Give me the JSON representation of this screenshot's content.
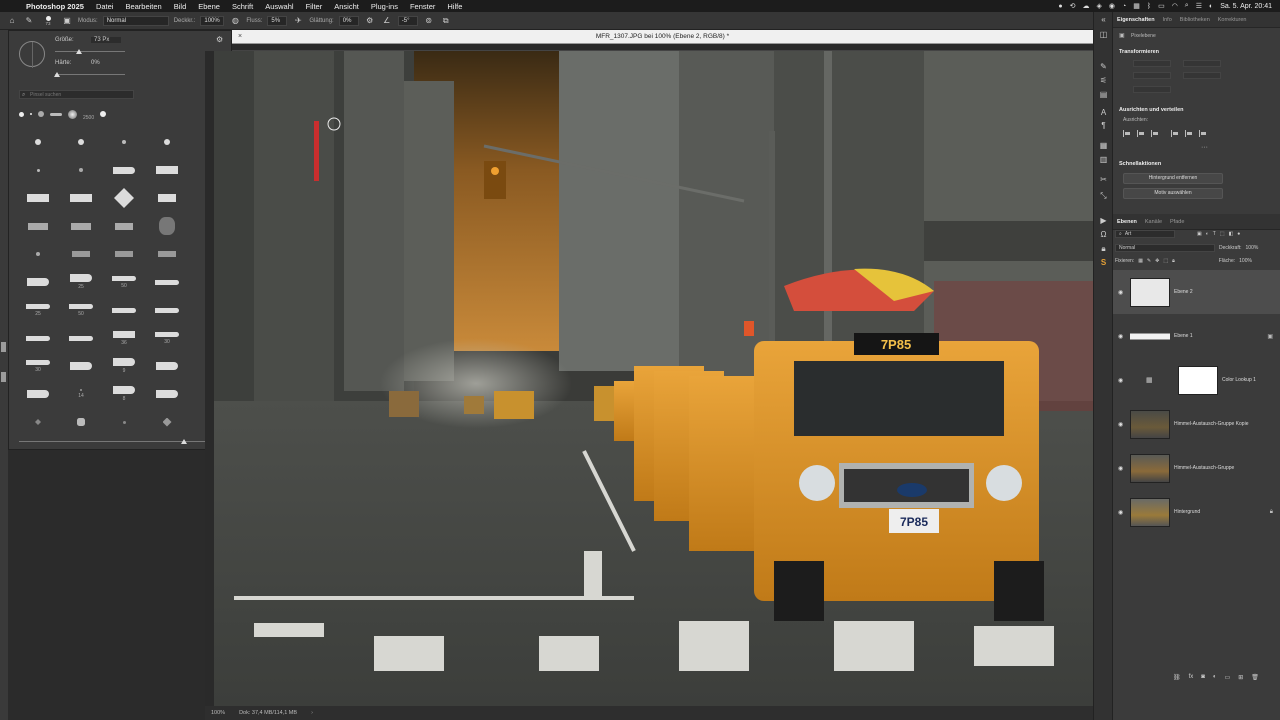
{
  "menubar": {
    "app_name": "Photoshop 2025",
    "items": [
      "Datei",
      "Bearbeiten",
      "Bild",
      "Ebene",
      "Schrift",
      "Auswahl",
      "Filter",
      "Ansicht",
      "Plug-ins",
      "Fenster",
      "Hilfe"
    ],
    "datetime": "Sa. 5. Apr. 20:41"
  },
  "options_bar": {
    "brush_size": "73",
    "mode_label": "Modus:",
    "mode_value": "Normal",
    "opacity_label": "Deckkr.:",
    "opacity_value": "100%",
    "flow_label": "Fluss:",
    "flow_value": "5%",
    "smoothing_label": "Glättung:",
    "smoothing_value": "0%",
    "angle_value": "-5°"
  },
  "brush_panel": {
    "size_label": "Größe:",
    "size_value": "73 Px",
    "hardness_label": "Härte:",
    "hardness_value": "0%",
    "search_placeholder": "Pinsel suchen",
    "recent_number": "2500",
    "brush_numbers": [
      "25",
      "50",
      "25",
      "50",
      "36",
      "30",
      "30",
      "9",
      "14",
      "8"
    ]
  },
  "document": {
    "title": "MFR_1307.JPG bei 100% (Ebene 2, RGB/8) *",
    "zoom": "100%",
    "doc_info": "Dok: 37,4 MB/114,1 MB",
    "taxi_plate": "7P85"
  },
  "properties": {
    "tabs": [
      "Eigenschaften",
      "Info",
      "Bibliotheken",
      "Korrekturen"
    ],
    "layer_type": "Pixelebene",
    "transform_title": "Transformieren",
    "align_title": "Ausrichten und verteilen",
    "align_sub": "Ausrichten:",
    "quick_actions_title": "Schnellaktionen",
    "remove_bg_label": "Hintergrund entfernen",
    "select_subject_label": "Motiv auswählen"
  },
  "layers": {
    "tabs": [
      "Ebenen",
      "Kanäle",
      "Pfade"
    ],
    "filter_kind": "Art",
    "blend_mode": "Normal",
    "opacity_label": "Deckkraft:",
    "opacity_value": "100%",
    "lock_label": "Fixieren:",
    "fill_label": "Fläche:",
    "fill_value": "100%",
    "items": [
      {
        "name": "Ebene 2"
      },
      {
        "name": "Ebene 1"
      },
      {
        "name": "Color Lookup 1"
      },
      {
        "name": "Himmel-Austausch-Gruppe Kopie"
      },
      {
        "name": "Himmel-Austausch-Gruppe"
      },
      {
        "name": "Hintergrund"
      }
    ]
  }
}
